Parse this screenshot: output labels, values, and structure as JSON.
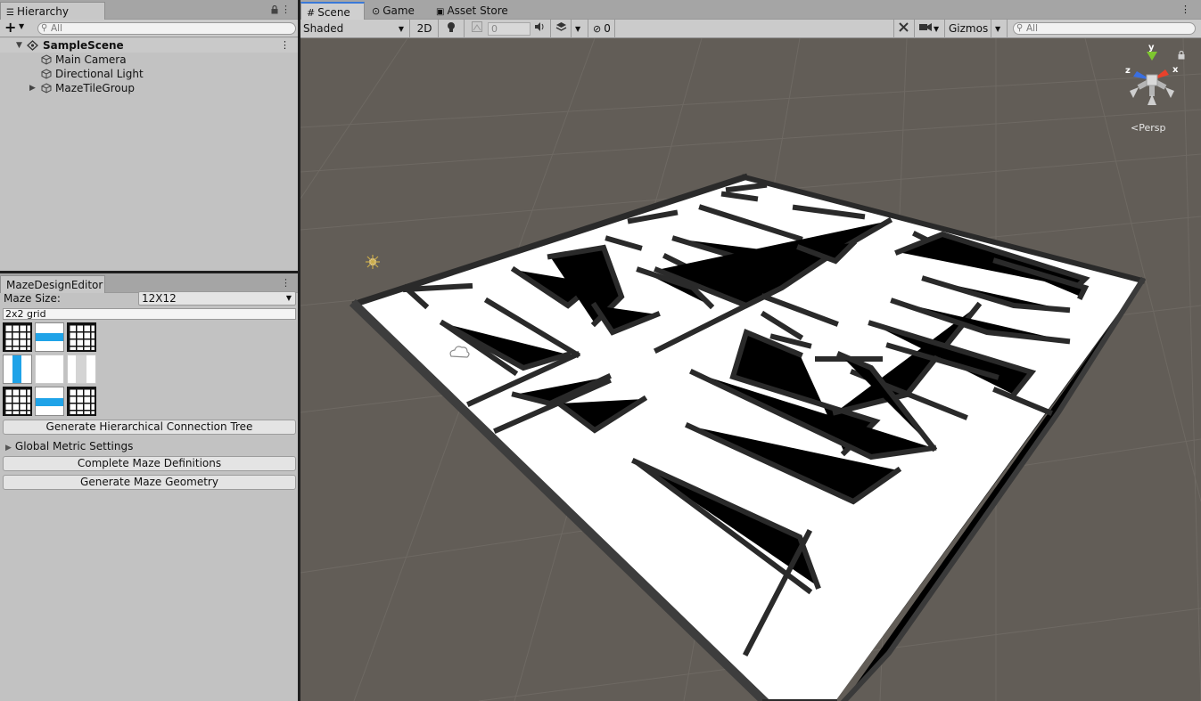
{
  "hierarchy": {
    "tab_label": "Hierarchy",
    "search_placeholder": "All",
    "scene_name": "SampleScene",
    "items": [
      {
        "label": "Main Camera",
        "expandable": false
      },
      {
        "label": "Directional Light",
        "expandable": false
      },
      {
        "label": "MazeTileGroup",
        "expandable": true
      }
    ]
  },
  "maze_editor": {
    "tab_label": "MazeDesignEditor",
    "maze_size_label": "Maze Size:",
    "maze_size_value": "12X12",
    "grid_field_value": "2x2 grid",
    "tiles": [
      "grid-tile-icon",
      "horizontal-path-tile-icon",
      "grid-tile-icon",
      "vertical-path-tile-icon",
      "empty-tile-icon",
      "vertical-walls-tile-icon",
      "grid-tile-icon",
      "horizontal-path-tile-icon",
      "grid-tile-icon"
    ],
    "generate_tree_button": "Generate Hierarchical Connection Tree",
    "global_metric_label": "Global Metric Settings",
    "complete_definitions_button": "Complete Maze Definitions",
    "generate_geometry_button": "Generate Maze Geometry"
  },
  "scene_tabs": {
    "scene": "Scene",
    "game": "Game",
    "asset_store": "Asset Store"
  },
  "scene_toolbar": {
    "draw_mode": "Shaded",
    "mode_2d": "2D",
    "fx_value": "0",
    "hidden_count": "0",
    "gizmos_label": "Gizmos",
    "search_placeholder": "All"
  },
  "gizmo": {
    "x_label": "x",
    "y_label": "y",
    "z_label": "z",
    "projection_label": "Persp"
  },
  "colors": {
    "axis_x": "#e8412b",
    "axis_y": "#7ec72f",
    "axis_z": "#3a6fe0",
    "selection_blue": "#1fa3e8",
    "scene_background": "#625d57"
  }
}
